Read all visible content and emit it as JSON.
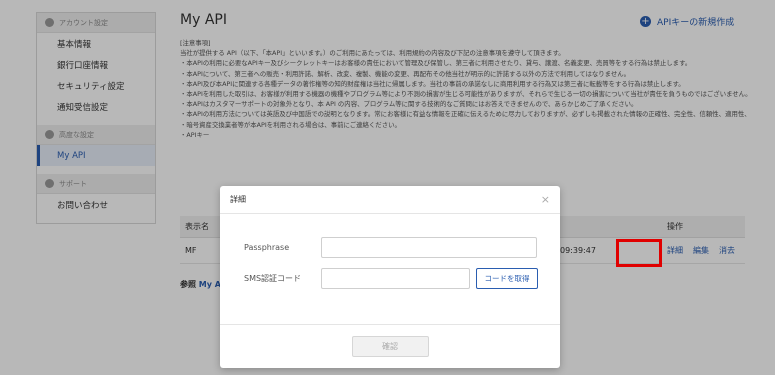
{
  "sidebar": {
    "sections": [
      {
        "title": "アカウント設定",
        "items": [
          "基本情報",
          "銀行口座情報",
          "セキュリティ設定",
          "通知受信設定"
        ]
      },
      {
        "title": "高度な設定",
        "items": [
          "My API"
        ]
      },
      {
        "title": "サポート",
        "items": [
          "お問い合わせ"
        ]
      }
    ],
    "active_item": "My API"
  },
  "main": {
    "title": "My API",
    "new_key_label": "APIキーの新規作成",
    "notes": [
      "[注意事項]",
      "当社が提供する API（以下、「本API」といいます。）のご利用にあたっては、利用規約の内容及び下記の注意事項を遵守して頂きます。",
      "・本APIの利用に必要なAPIキー及びシークレットキーはお客様の責任において管理及び保管し、第三者に利用させたり、貸与、譲渡、名義変更、売買等をする行為は禁止します。",
      "・本APIについて、第三者への販売・利用許諾、解析、改変、複製、機能の変更、再配布その他当社が明示的に許諾する以外の方法で利用してはなりません。",
      "・本API及び本APIに関連する各種データの著作権等の知的財産権は当社に帰属します。当社の事前の承諾なしに商用利用する行為又は第三者に転載等をする行為は禁止します。",
      "・本APIを利用した取引は、お客様が利用する機器の機種やプログラム等により不測の損害が生じる可能性がありますが、それらで生じる一切の損害について当社が責任を負うものではございません。",
      "・本APIはカスタマーサポートの対象外となり、本 API の内容、プログラム等に関する技術的なご質問にはお答えできませんので、あらかじめご了承ください。",
      "・本APIの利用方法については英語及び中国語での説明となります。常にお客様に有益な情報を正確に伝えるために尽力しておりますが、必ずしも掲載された情報の正確性、完全性、信頼性、適用性、有用性等いかなる保証をするものではありません。情報利用の結果生じたいかなる損失においても、当社は一切責任を負いませんので、あらかじめご了承ください。",
      "・暗号資産交換業者等が本APIを利用される場合は、事前にご連絡ください。",
      "・APIキー"
    ],
    "table": {
      "headers": {
        "name": "表示名",
        "actions": "操作"
      },
      "rows": [
        {
          "name": "MF",
          "time": "09:39:47",
          "actions": [
            "詳細",
            "編集",
            "消去"
          ]
        }
      ]
    },
    "reference_prefix": "参照",
    "reference_link": "My API"
  },
  "modal": {
    "title": "詳細",
    "close": "×",
    "passphrase_label": "Passphrase",
    "passphrase_value": "",
    "sms_label": "SMS認証コード",
    "sms_value": "",
    "sms_button": "コードを取得",
    "confirm_button": "確認"
  },
  "colors": {
    "accent": "#2a5db0",
    "highlight": "#e00000"
  }
}
